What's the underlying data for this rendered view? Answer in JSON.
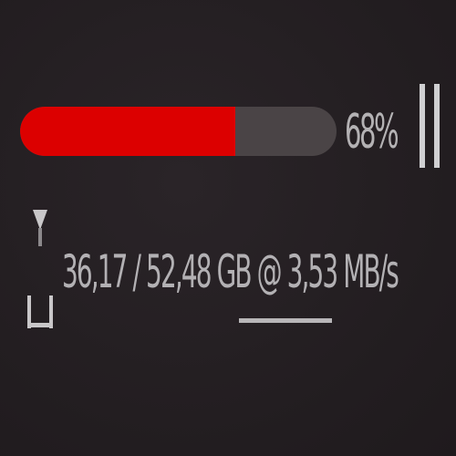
{
  "download": {
    "progress_percent": 68,
    "progress_label": "68%",
    "downloaded": "36,17",
    "separator": " / ",
    "total": "52,48",
    "unit": " GB @ ",
    "speed": "3,53",
    "speed_unit": " MB/s"
  },
  "colors": {
    "progress_fill": "#dc0000",
    "progress_track": "#4a4446",
    "text": "#b3b1b4",
    "background": "#241f22"
  },
  "icons": {
    "pause": "pause-icon",
    "download": "download-icon"
  }
}
